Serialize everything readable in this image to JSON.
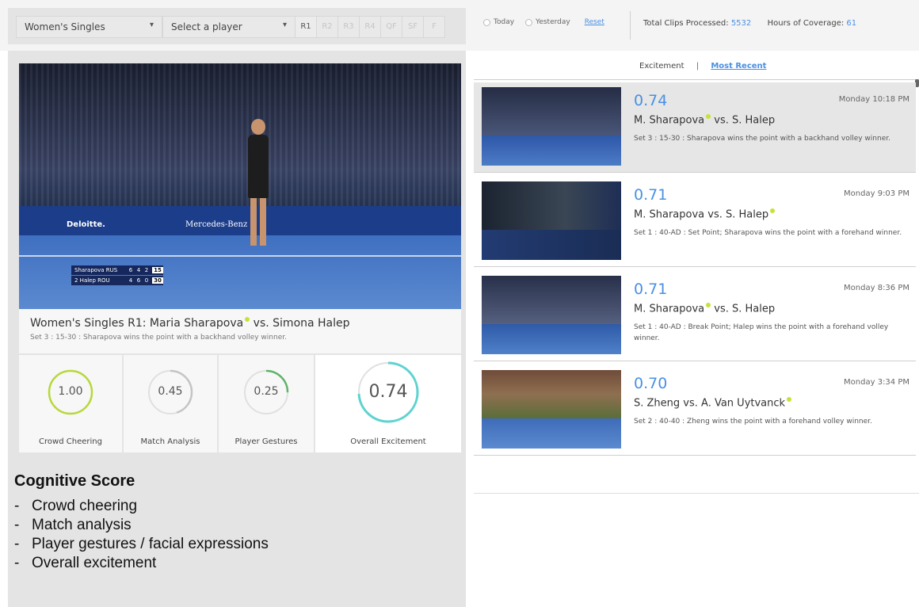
{
  "filters": {
    "event": "Women's Singles",
    "player_placeholder": "Select a player",
    "rounds": [
      "R1",
      "R2",
      "R3",
      "R4",
      "QF",
      "SF",
      "F"
    ],
    "active_round": "R1",
    "date_options": [
      "Today",
      "Yesterday"
    ],
    "reset_label": "Reset"
  },
  "stats": {
    "clips_label": "Total Clips Processed:",
    "clips_value": "5532",
    "hours_label": "Hours of Coverage:",
    "hours_value": "61"
  },
  "video": {
    "sponsors": [
      "Deloitte.",
      "Mercedes-Benz"
    ],
    "scoreboard": [
      {
        "name": "Sharapova RUS",
        "sets": [
          "6",
          "4",
          "2"
        ],
        "points": "15"
      },
      {
        "name": "2 Halep ROU",
        "sets": [
          "4",
          "6",
          "0"
        ],
        "points": "30"
      }
    ],
    "title": "Women's Singles R1: Maria Sharapova",
    "title_suffix": " vs. Simona Halep",
    "subtitle": "Set 3 : 15-30 : Sharapova wins the point with a backhand volley winner."
  },
  "scores": [
    {
      "label": "Crowd Cheering",
      "value": "1.00",
      "fraction": 1.0,
      "color": "#b7d83a"
    },
    {
      "label": "Match Analysis",
      "value": "0.45",
      "fraction": 0.45,
      "color": "#c4c4c4"
    },
    {
      "label": "Player Gestures",
      "value": "0.25",
      "fraction": 0.25,
      "color": "#5fb36b"
    },
    {
      "label": "Overall Excitement",
      "value": "0.74",
      "fraction": 0.74,
      "color": "#5fd3d0"
    }
  ],
  "cognitive": {
    "title": "Cognitive Score",
    "items": [
      "Crowd cheering",
      "Match analysis",
      "Player gestures / facial expressions",
      "Overall excitement"
    ]
  },
  "sort": {
    "options": [
      "Excitement",
      "Most Recent"
    ],
    "separator": "|",
    "active": "Most Recent"
  },
  "clips": [
    {
      "score": "0.74",
      "time": "Monday 10:18 PM",
      "p1": "M. Sharapova",
      "p2": "S. Halep",
      "winner": 1,
      "desc": "Set 3 : 15-30 : Sharapova wins the point with a backhand volley winner.",
      "selected": true
    },
    {
      "score": "0.71",
      "time": "Monday 9:03 PM",
      "p1": "M. Sharapova",
      "p2": "S. Halep",
      "winner": 2,
      "desc": "Set 1 : 40-AD : Set Point; Sharapova wins the point with a forehand winner.",
      "selected": false
    },
    {
      "score": "0.71",
      "time": "Monday 8:36 PM",
      "p1": "M. Sharapova",
      "p2": "S. Halep",
      "winner": 1,
      "desc": "Set 1 : 40-AD : Break Point; Halep wins the point with a forehand volley winner.",
      "selected": false
    },
    {
      "score": "0.70",
      "time": "Monday 3:34 PM",
      "p1": "S. Zheng",
      "p2": "A. Van Uytvanck",
      "winner": 2,
      "desc": "Set 2 : 40-40 : Zheng wins the point with a forehand volley winner.",
      "selected": false
    }
  ],
  "icons": {
    "caret": "chevron-down-icon",
    "serve_dot": "serve-indicator-icon"
  },
  "colors": {
    "accent": "#4a90e2",
    "serve_dot": "#c8e13a",
    "panel_bg": "#e4e4e4"
  }
}
